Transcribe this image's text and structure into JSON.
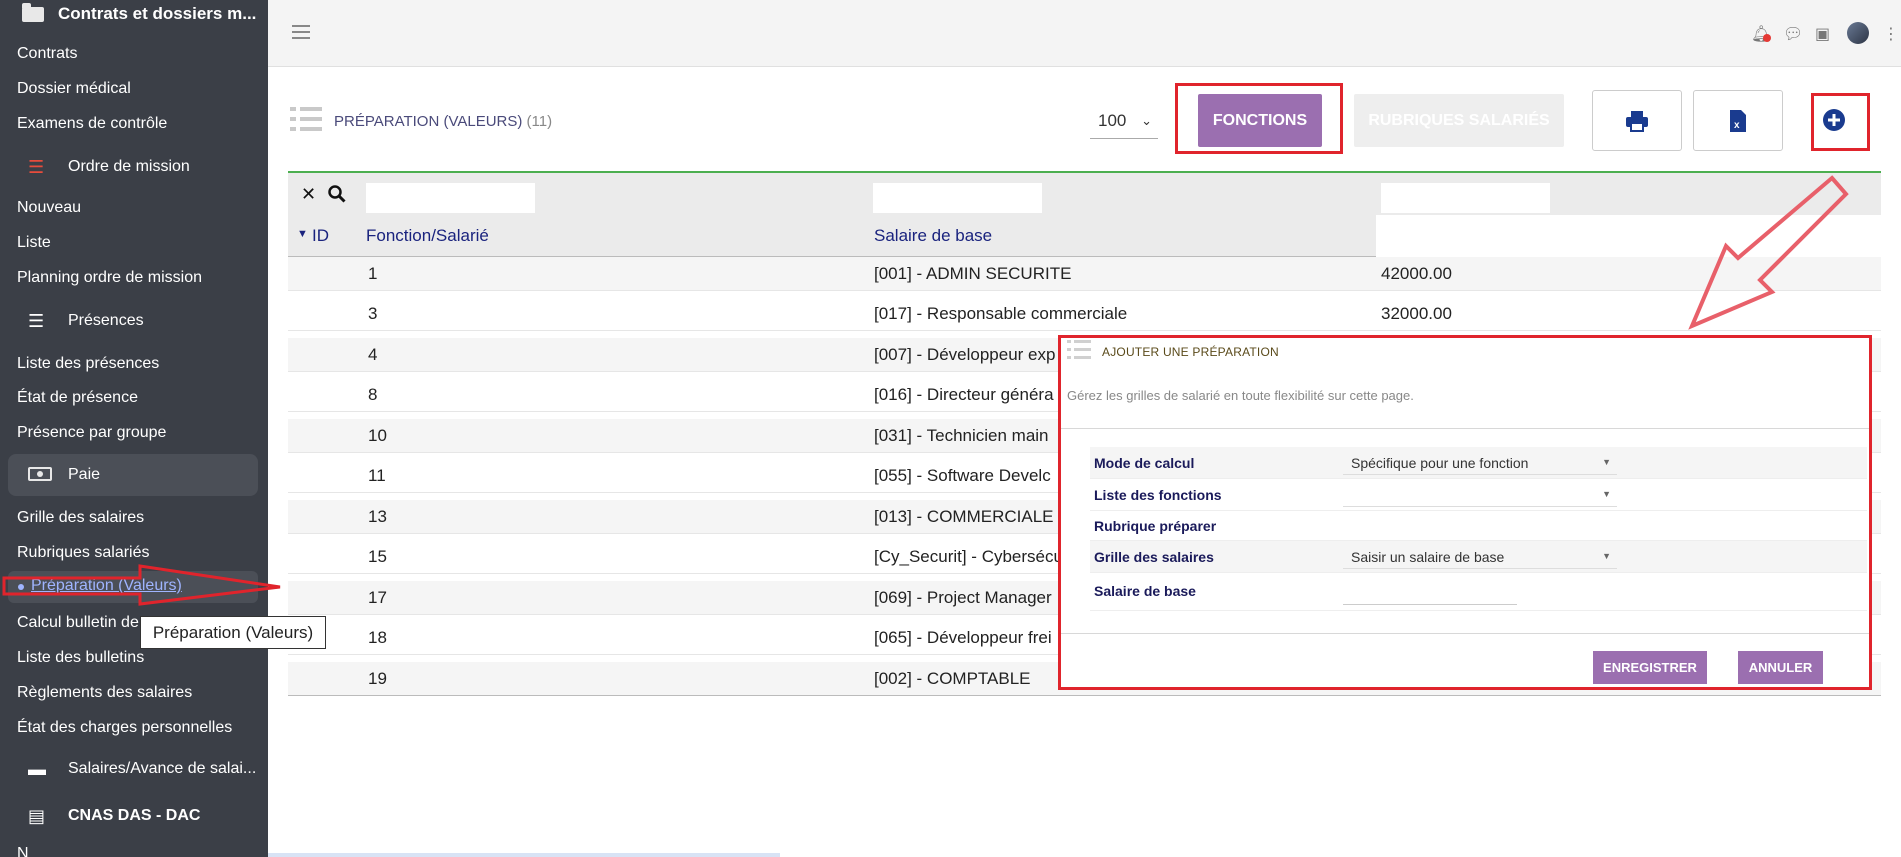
{
  "sidebar": {
    "header": "Contrats et dossiers m...",
    "items": {
      "contrats": "Contrats",
      "dossier_medical": "Dossier médical",
      "examens": "Examens de contrôle",
      "ordre_mission": "Ordre de mission",
      "nouveau": "Nouveau",
      "liste": "Liste",
      "planning": "Planning ordre de mission",
      "presences": "Présences",
      "liste_presences": "Liste des présences",
      "etat_presence": "État de présence",
      "presence_groupe": "Présence par groupe",
      "paie": "Paie",
      "grille_salaires": "Grille des salaires",
      "rubriques_salaries": "Rubriques salariés",
      "preparation": "Préparation (Valeurs)",
      "calcul_bulletin": "Calcul bulletin de",
      "liste_bulletins": "Liste des bulletins",
      "reglements": "Règlements des salaires",
      "etat_charges": "État des charges personnelles",
      "salaires_avance": "Salaires/Avance de salai...",
      "cnas": "CNAS DAS - DAC",
      "cut_item": "N"
    }
  },
  "tooltip": "Préparation (Valeurs)",
  "page": {
    "title": "PRÉPARATION (VALEURS)",
    "count": "(11)",
    "page_size": "100",
    "btn_fonctions": "FONCTIONS",
    "btn_rubriques": "RUBRIQUES SALARIÉS"
  },
  "table": {
    "headers": {
      "id": "ID",
      "fonction": "Fonction/Salarié",
      "salaire": "Salaire de base"
    },
    "rows": [
      {
        "id": "1",
        "fonction": "[001] - ADMIN SECURITE",
        "salaire": "42000.00"
      },
      {
        "id": "3",
        "fonction": "[017] - Responsable commerciale",
        "salaire": "32000.00"
      },
      {
        "id": "4",
        "fonction": "[007] - Développeur exp",
        "salaire": ""
      },
      {
        "id": "8",
        "fonction": "[016] - Directeur généra",
        "salaire": ""
      },
      {
        "id": "10",
        "fonction": "[031] - Technicien main",
        "salaire": ""
      },
      {
        "id": "11",
        "fonction": "[055] - Software Develc",
        "salaire": ""
      },
      {
        "id": "13",
        "fonction": "[013] - COMMERCIALE",
        "salaire": ""
      },
      {
        "id": "15",
        "fonction": "[Cy_Securit] - Cybersécu",
        "salaire": ""
      },
      {
        "id": "17",
        "fonction": "[069] - Project Manager",
        "salaire": ""
      },
      {
        "id": "18",
        "fonction": "[065] - Développeur frei",
        "salaire": ""
      },
      {
        "id": "19",
        "fonction": "[002] - COMPTABLE",
        "salaire": ""
      }
    ]
  },
  "modal": {
    "title": "AJOUTER UNE PRÉPARATION",
    "subtitle": "Gérez les grilles de salarié en toute flexibilité sur cette page.",
    "fields": {
      "mode_calcul_label": "Mode de calcul",
      "mode_calcul_value": "Spécifique pour une fonction",
      "liste_fonctions_label": "Liste des fonctions",
      "liste_fonctions_value": "",
      "rubrique_label": "Rubrique préparer",
      "grille_label": "Grille des salaires",
      "grille_value": "Saisir un salaire de base",
      "salaire_label": "Salaire de base"
    },
    "btn_save": "ENREGISTRER",
    "btn_cancel": "ANNULER"
  },
  "colors": {
    "sidebar_bg": "#3b3f47",
    "accent_purple": "#9b6fb0",
    "annotation_red": "#e0242c",
    "table_header_text": "#1a237e"
  }
}
